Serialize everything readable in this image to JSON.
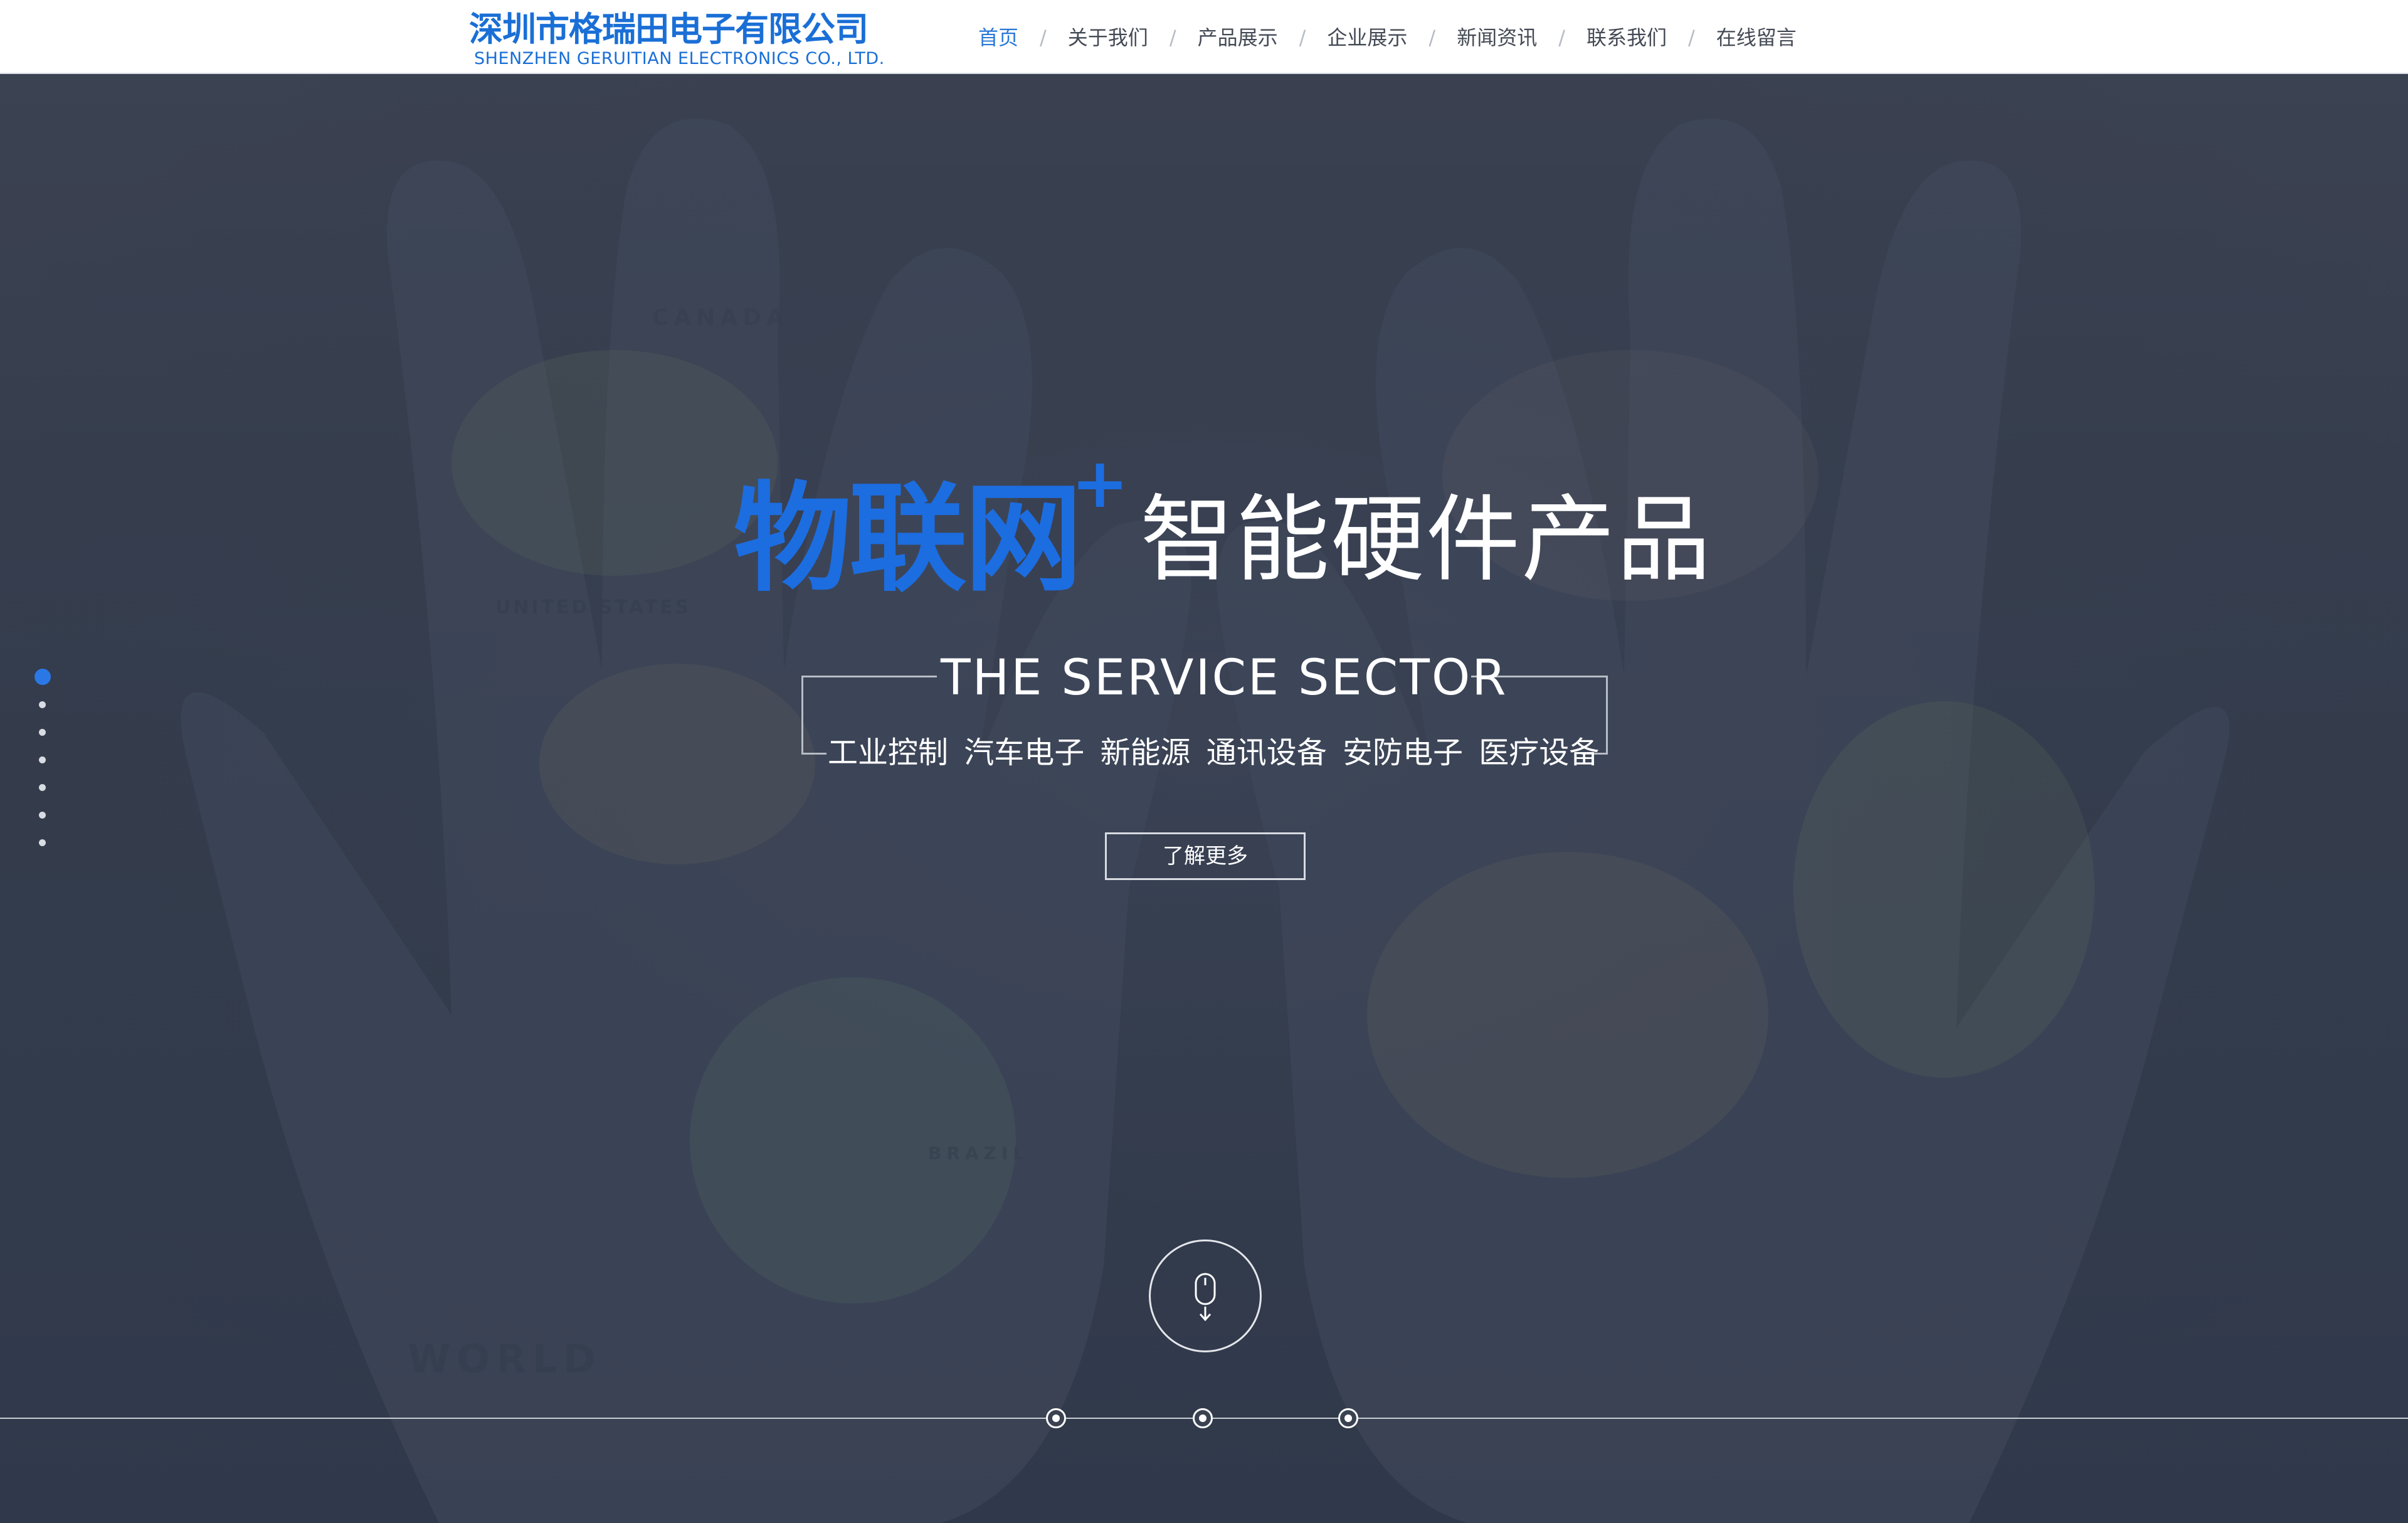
{
  "header": {
    "logo_cn": "深圳市格瑞田电子有限公司",
    "logo_en": "SHENZHEN GERUITIAN ELECTRONICS CO., LTD.",
    "nav": [
      {
        "label": "首页",
        "active": true
      },
      {
        "label": "关于我们",
        "active": false
      },
      {
        "label": "产品展示",
        "active": false
      },
      {
        "label": "企业展示",
        "active": false
      },
      {
        "label": "新闻资讯",
        "active": false
      },
      {
        "label": "联系我们",
        "active": false
      },
      {
        "label": "在线留言",
        "active": false
      }
    ],
    "separator": "/"
  },
  "hero": {
    "headline_blue": "物联网",
    "headline_plus": "+",
    "headline_white": "智能硬件产品",
    "sector_title": "THE SERVICE SECTOR",
    "sector_sub": "工业控制  汽车电子  新能源  通讯设备  安防电子  医疗设备",
    "button": "了解更多",
    "map_labels": [
      "CANADA",
      "UNITED STATES",
      "BRAZIL",
      "WORLD"
    ],
    "slide_count": 7,
    "active_slide": 1,
    "timeline_nodes": 3
  },
  "colors": {
    "brand_blue": "#1a6fd6",
    "accent_blue": "#1c6de0",
    "nav_active": "#2a78d8",
    "hero_bg": "#3a4252"
  },
  "icons": {
    "scroll": "mouse-scroll-down-icon"
  }
}
